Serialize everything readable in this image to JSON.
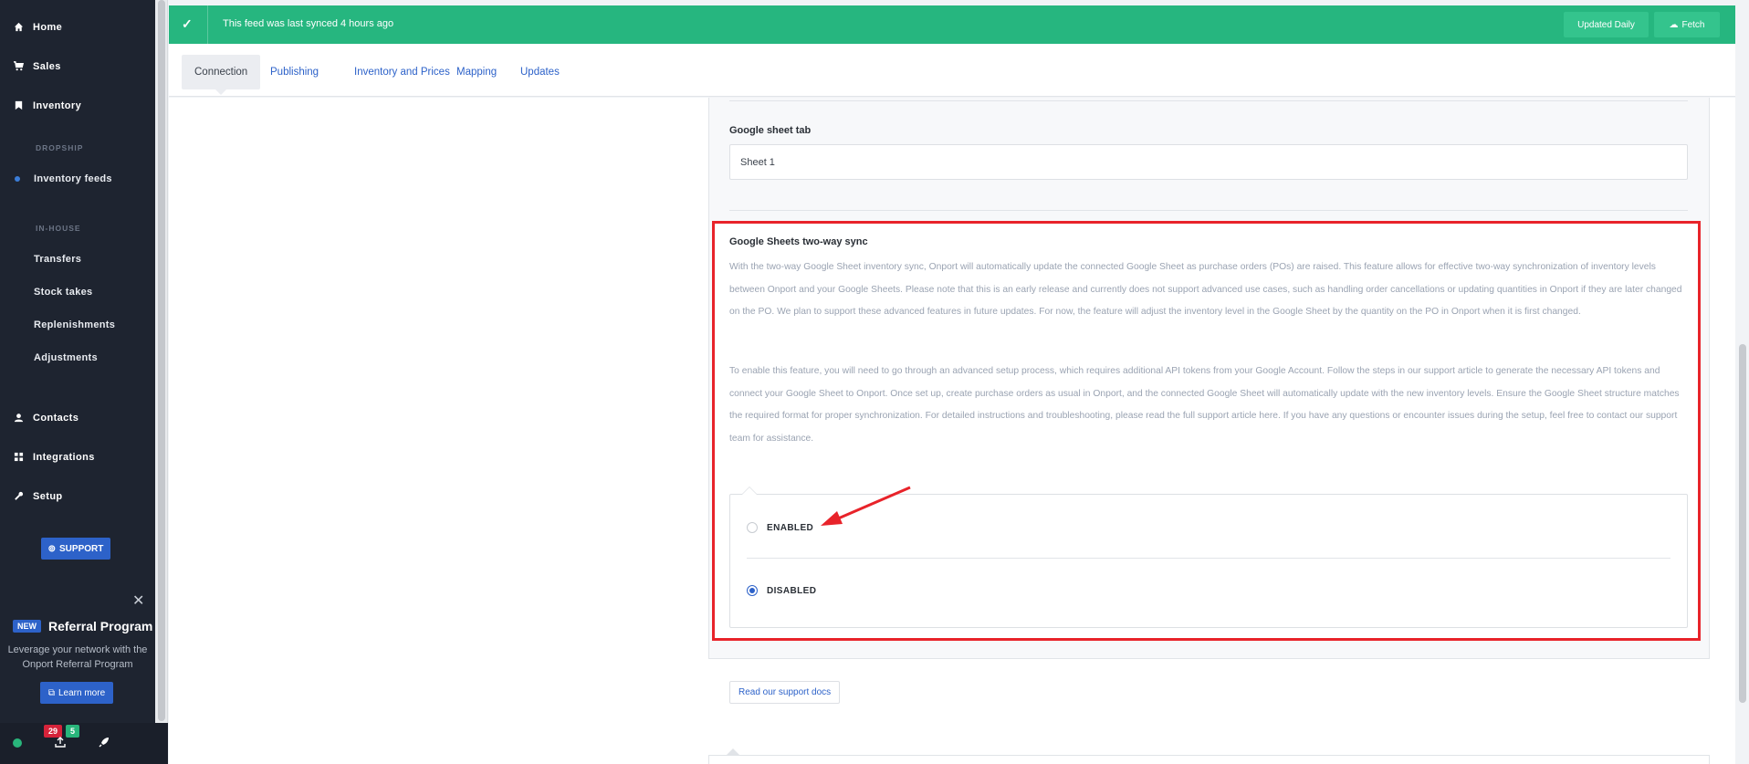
{
  "sidebar": {
    "nav": [
      {
        "label": "Home",
        "icon": "home-icon"
      },
      {
        "label": "Sales",
        "icon": "cart-icon"
      },
      {
        "label": "Inventory",
        "icon": "bookmark-icon"
      }
    ],
    "dropship_header": "DROPSHIP",
    "dropship_items": [
      "Inventory feeds"
    ],
    "inhouse_header": "IN-HOUSE",
    "inhouse_items": [
      "Transfers",
      "Stock takes",
      "Replenishments",
      "Adjustments"
    ],
    "nav2": [
      {
        "label": "Contacts",
        "icon": "user-icon"
      },
      {
        "label": "Integrations",
        "icon": "grid-icon"
      },
      {
        "label": "Setup",
        "icon": "wrench-icon"
      }
    ],
    "support_label": "SUPPORT"
  },
  "referral": {
    "badge": "NEW",
    "title": "Referral Program",
    "description": "Leverage your network with the Onport Referral Program",
    "button": "Learn more"
  },
  "bottom_bar": {
    "badge_red": "29",
    "badge_green": "5"
  },
  "banner": {
    "message": "This feed was last synced 4 hours ago",
    "updated_daily": "Updated Daily",
    "fetch": "Fetch"
  },
  "tabs": [
    "Connection",
    "Publishing",
    "Inventory and Prices",
    "Mapping",
    "Updates"
  ],
  "active_tab": "Connection",
  "form": {
    "sheet_tab_label": "Google sheet tab",
    "sheet_tab_value": "Sheet 1",
    "sync_title": "Google Sheets two-way sync",
    "sync_para_1": "With the two-way Google Sheet inventory sync, Onport will automatically update the connected Google Sheet as purchase orders (POs) are raised. This feature allows for effective two-way synchronization of inventory levels between Onport and your Google Sheets. Please note that this is an early release and currently does not support advanced use cases, such as handling order cancellations or updating quantities in Onport if they are later changed on the PO. We plan to support these advanced features in future updates. For now, the feature will adjust the inventory level in the Google Sheet by the quantity on the PO in Onport when it is first changed.",
    "sync_para_2": "To enable this feature, you will need to go through an advanced setup process, which requires additional API tokens from your Google Account. Follow the steps in our support article to generate the necessary API tokens and connect your Google Sheet to Onport. Once set up, create purchase orders as usual in Onport, and the connected Google Sheet will automatically update with the new inventory levels. Ensure the Google Sheet structure matches the required format for proper synchronization. For detailed instructions and troubleshooting, please read the full support article here. If you have any questions or encounter issues during the setup, feel free to contact our support team for assistance.",
    "option_enabled": "ENABLED",
    "option_disabled": "DISABLED",
    "selected_option": "DISABLED",
    "docs_button": "Read our support docs"
  },
  "colors": {
    "banner": "#26b67f",
    "accent": "#2d62c9",
    "highlight": "#e8232a",
    "sidebar": "#1e2430"
  }
}
